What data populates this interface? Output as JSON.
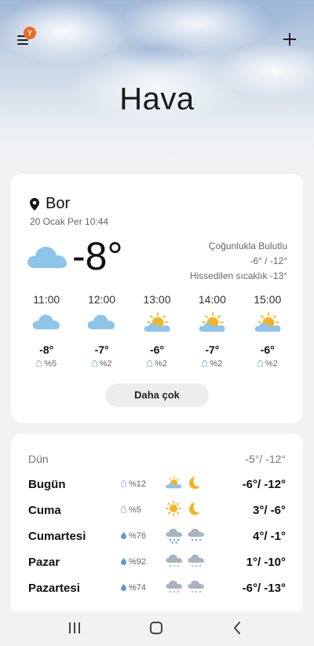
{
  "header": {
    "title": "Hava",
    "menu_badge": "Y"
  },
  "current": {
    "location": "Bor",
    "date": "20 Ocak Per 10:44",
    "temperature": "-8°",
    "condition": "Çoğunlukla Bulutlu",
    "high_low": "-6° / -12°",
    "feels_like": "Hissedilen sıcaklık -13°"
  },
  "hourly": [
    {
      "time": "11:00",
      "icon": "cloud-icon",
      "temp": "-8°",
      "precip": "%5"
    },
    {
      "time": "12:00",
      "icon": "cloud-icon",
      "temp": "-7°",
      "precip": "%2"
    },
    {
      "time": "13:00",
      "icon": "partly-sunny-icon",
      "temp": "-6°",
      "precip": "%2"
    },
    {
      "time": "14:00",
      "icon": "partly-sunny-icon",
      "temp": "-7°",
      "precip": "%2"
    },
    {
      "time": "15:00",
      "icon": "partly-sunny-icon",
      "temp": "-6°",
      "precip": "%2"
    }
  ],
  "more_label": "Daha çok",
  "daily": [
    {
      "day": "Dün",
      "precip": "",
      "temps": "-5°/ -12°",
      "past": true
    },
    {
      "day": "Bugün",
      "precip": "%12",
      "icons": [
        "partly-sunny-icon",
        "moon-icon"
      ],
      "temps": "-6°/ -12°"
    },
    {
      "day": "Cuma",
      "precip": "%5",
      "icons": [
        "sun-icon",
        "moon-icon"
      ],
      "temps": "3°/ -6°"
    },
    {
      "day": "Cumartesi",
      "precip": "%76",
      "icons": [
        "snow-cloud-icon",
        "snow-cloud-icon"
      ],
      "temps": "4°/ -1°"
    },
    {
      "day": "Pazar",
      "precip": "%92",
      "icons": [
        "snow-cloud-icon",
        "snow-cloud-icon"
      ],
      "temps": "1°/ -10°"
    },
    {
      "day": "Pazartesi",
      "precip": "%74",
      "icons": [
        "snow-cloud-icon",
        "snow-cloud-icon"
      ],
      "temps": "-6°/ -13°"
    }
  ],
  "colors": {
    "cloud": "#8fc4ea",
    "sun": "#f5b323",
    "badge": "#f06a1d"
  }
}
